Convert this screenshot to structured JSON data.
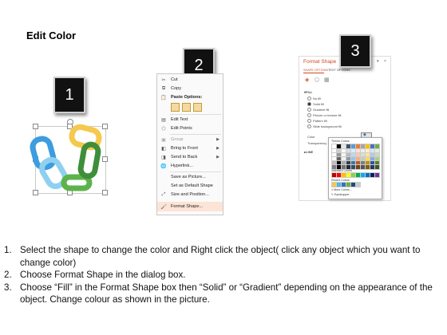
{
  "slide": {
    "title": "Edit Color"
  },
  "steps": {
    "one": "1",
    "two": "2",
    "three": "3"
  },
  "context_menu": {
    "items": [
      {
        "label": "Cut",
        "icon": "scissors-icon"
      },
      {
        "label": "Copy",
        "icon": "copy-icon"
      },
      {
        "label": "Paste Options:",
        "icon": "paste-icon"
      },
      {
        "label": "",
        "icon": "paste-options-icons"
      },
      {
        "label": "Edit Text",
        "icon": "edit-text-icon"
      },
      {
        "label": "Edit Points",
        "icon": "edit-points-icon"
      },
      {
        "label": "Group",
        "icon": "group-icon",
        "disabled": true,
        "submenu": true
      },
      {
        "label": "Bring to Front",
        "icon": "bring-front-icon",
        "submenu": true
      },
      {
        "label": "Send to Back",
        "icon": "send-back-icon",
        "submenu": true
      },
      {
        "label": "Hyperlink...",
        "icon": "hyperlink-icon"
      },
      {
        "label": "Save as Picture...",
        "icon": ""
      },
      {
        "label": "Set as Default Shape",
        "icon": ""
      },
      {
        "label": "Size and Position...",
        "icon": "size-position-icon"
      },
      {
        "label": "Format Shape...",
        "icon": "format-shape-icon"
      }
    ]
  },
  "format_pane": {
    "title": "Format Shape",
    "tab_shape": "SHAPE OPTIONS",
    "tab_text": "TEXT OPTIONS",
    "fill_header": "FILL",
    "fill_options": [
      "No fill",
      "Solid fill",
      "Gradient fill",
      "Picture or texture fill",
      "Pattern fill",
      "Slide background fill"
    ],
    "selected_fill": "Solid fill",
    "color_label": "Color",
    "transparency_label": "Transparency",
    "line_header": "LINE"
  },
  "palette": {
    "theme_label": "Theme Colors",
    "standard_label": "Standard Colors",
    "recent_label": "Recent Colors",
    "more_colors": "More Colors...",
    "eyedropper": "Eyedropper",
    "theme_top": [
      "#ffffff",
      "#000000",
      "#e7e6e6",
      "#44546a",
      "#5b9bd5",
      "#ed7d31",
      "#a5a5a5",
      "#ffc000",
      "#4472c4",
      "#70ad47"
    ],
    "standard": [
      "#c00000",
      "#ff0000",
      "#ffc000",
      "#ffff00",
      "#92d050",
      "#00b050",
      "#00b0f0",
      "#0070c0",
      "#002060",
      "#7030a0"
    ],
    "recent": [
      "#f7c64b",
      "#4fb5e8",
      "#2e75b6",
      "#70ad47",
      "#1f4e79",
      "#c9c9c9"
    ]
  },
  "instructions": [
    {
      "num": "1.",
      "text": "Select the shape to change the color and Right click the object( click any object which you want to change color)"
    },
    {
      "num": "2.",
      "text": "Choose Format Shape in the dialog box."
    },
    {
      "num": "3.",
      "text": "Choose “Fill” in the Format Shape box then “Solid” or “Gradient” depending on the appearance of the object. Change colour as shown in the picture."
    }
  ]
}
